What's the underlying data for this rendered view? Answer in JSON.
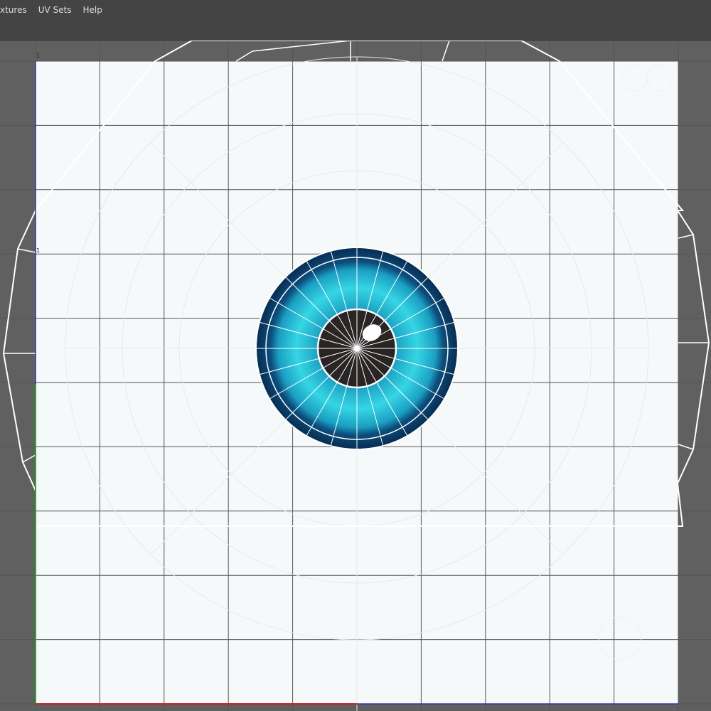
{
  "menu": {
    "items": [
      {
        "label": "xtures"
      },
      {
        "label": "UV Sets"
      },
      {
        "label": "Help"
      }
    ]
  },
  "viewport": {
    "texture": "eye-iris-texture",
    "range_top_label": "1",
    "range_mid_label": "1",
    "colors": {
      "background": "#606060",
      "uv_tile": "#f6f9f9",
      "grid_line": "#555555",
      "wire": "#ffffff",
      "iris_light": "#35d6e4",
      "iris_dark": "#0a3f6d",
      "pupil": "#2a2424",
      "u_axis": "#cc2222",
      "v_axis": "#22aa22"
    }
  }
}
